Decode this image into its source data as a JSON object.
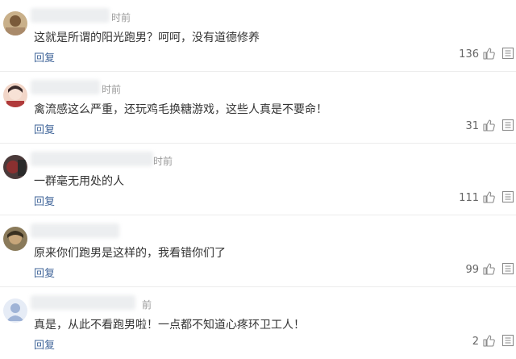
{
  "comments": [
    {
      "time_suffix": "时前",
      "text": "这就是所谓的阳光跑男？呵呵，没有道德修养",
      "reply_label": "回复",
      "likes": "136",
      "avatar_colors": [
        "#c9b08a",
        "#7a5a3a"
      ]
    },
    {
      "time_suffix": "时前",
      "text": "禽流感这么严重，还玩鸡毛换糖游戏，这些人真是不要命！",
      "reply_label": "回复",
      "likes": "31",
      "avatar_colors": [
        "#f2d6c8",
        "#3a2a2a"
      ]
    },
    {
      "time_suffix": "时前",
      "text": "一群毫无用处的人",
      "reply_label": "回复",
      "likes": "111",
      "avatar_colors": [
        "#8a3030",
        "#2a2a2a"
      ]
    },
    {
      "time_suffix": "",
      "text": "原来你们跑男是这样的，我看错你们了",
      "reply_label": "回复",
      "likes": "99",
      "avatar_colors": [
        "#8a7a5a",
        "#3a3020"
      ]
    },
    {
      "time_suffix": "前",
      "text": "真是，从此不看跑男啦！一点都不知道心疼环卫工人！",
      "reply_label": "回复",
      "likes": "2",
      "avatar_colors": [
        "#e6ecf6",
        "#9fb3d6"
      ]
    }
  ],
  "icons": {
    "like": "thumbs-up-icon",
    "more": "more-icon"
  },
  "colors": {
    "reply_link": "#406599",
    "divider": "#ececec",
    "time": "#9a9a9a"
  }
}
